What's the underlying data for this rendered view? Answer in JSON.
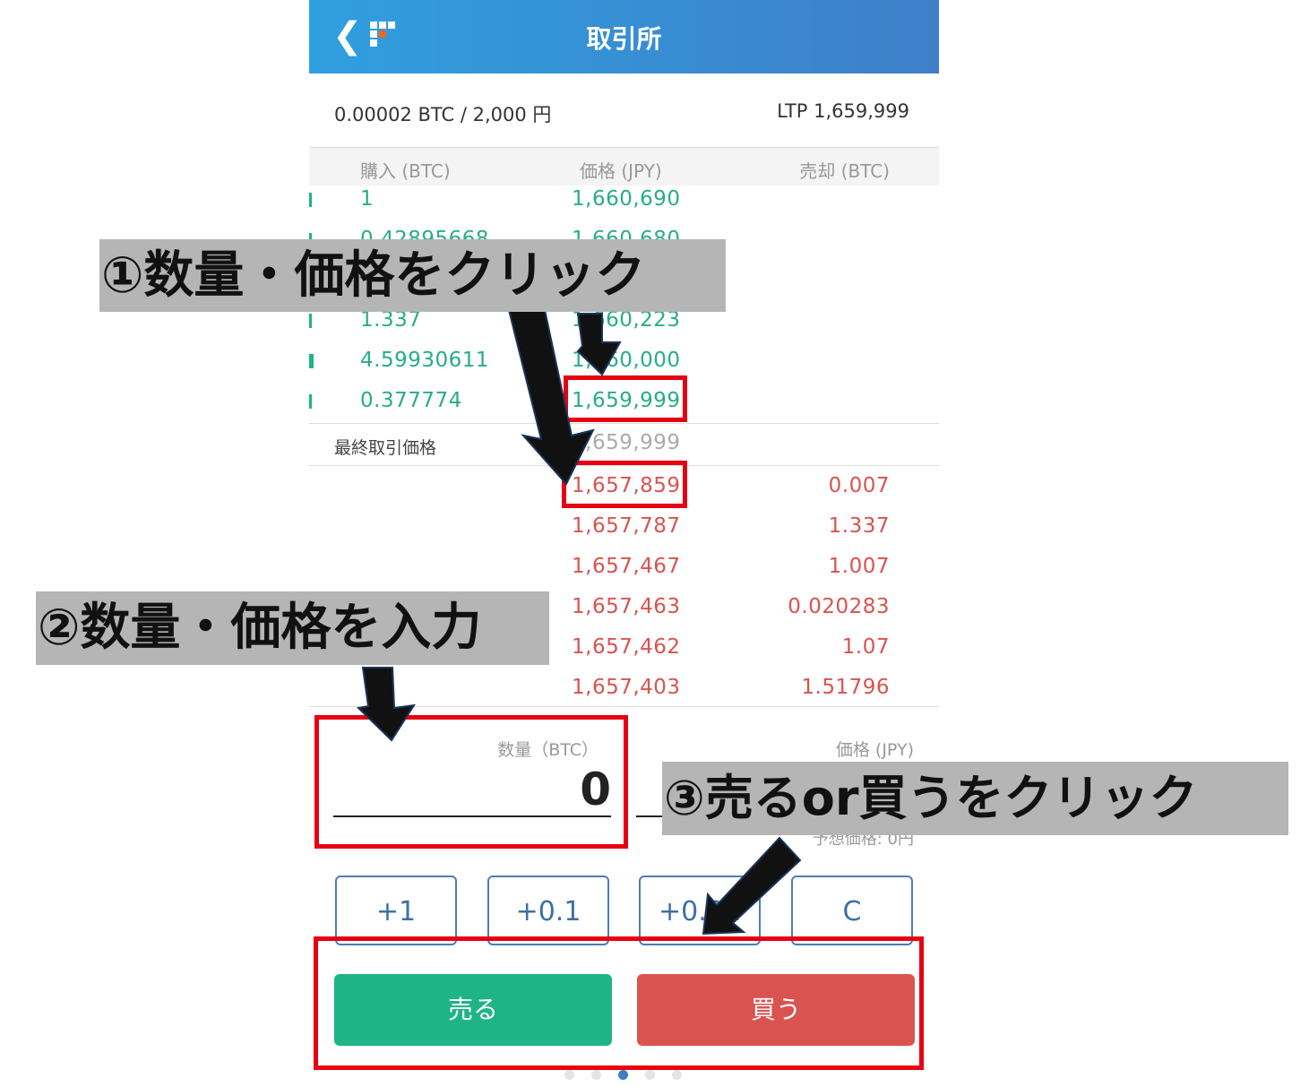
{
  "header": {
    "back_icon": "chevron-left-icon",
    "title": "取引所"
  },
  "summary": {
    "order_size": "0.00002 BTC / 2,000 円",
    "ltp": "LTP 1,659,999"
  },
  "columns": {
    "buy": "購入 (BTC)",
    "price": "価格 (JPY)",
    "sell": "売却 (BTC)"
  },
  "buy_orders": [
    {
      "volume": "1",
      "price": "1,660,690"
    },
    {
      "volume": "0.42895668",
      "price": "1,660,680"
    },
    {
      "volume": "",
      "price": ""
    },
    {
      "volume": "1.337",
      "price": "1,660,223"
    },
    {
      "volume": "4.59930611",
      "price": "1,660,000"
    },
    {
      "volume": "0.377774",
      "price": "1,659,999"
    }
  ],
  "last_trade": {
    "label": "最終取引価格",
    "price": "1,659,999"
  },
  "sell_orders": [
    {
      "price": "1,657,859",
      "volume": "0.007"
    },
    {
      "price": "1,657,787",
      "volume": "1.337"
    },
    {
      "price": "1,657,467",
      "volume": "1.007"
    },
    {
      "price": "1,657,463",
      "volume": "0.020283"
    },
    {
      "price": "1,657,462",
      "volume": "1.07"
    },
    {
      "price": "1,657,403",
      "volume": "1.51796"
    }
  ],
  "form": {
    "qty_label": "数量（BTC）",
    "qty_value": "0",
    "price_label": "価格 (JPY)",
    "estimate": "予想価格: 0円"
  },
  "increments": [
    "+1",
    "+0.1",
    "+0.01",
    "C"
  ],
  "actions": {
    "sell": "売る",
    "buy": "買う"
  },
  "pager": {
    "pages": 5,
    "active": 3
  },
  "annotations": {
    "step1": "①数量・価格をクリック",
    "step2": "②数量・価格を入力",
    "step3": "③売るor買うをクリック"
  },
  "colors": {
    "header": "#3a8fd8",
    "buy": "#1eb486",
    "sell": "#d9534f",
    "highlight": "#e60012"
  }
}
